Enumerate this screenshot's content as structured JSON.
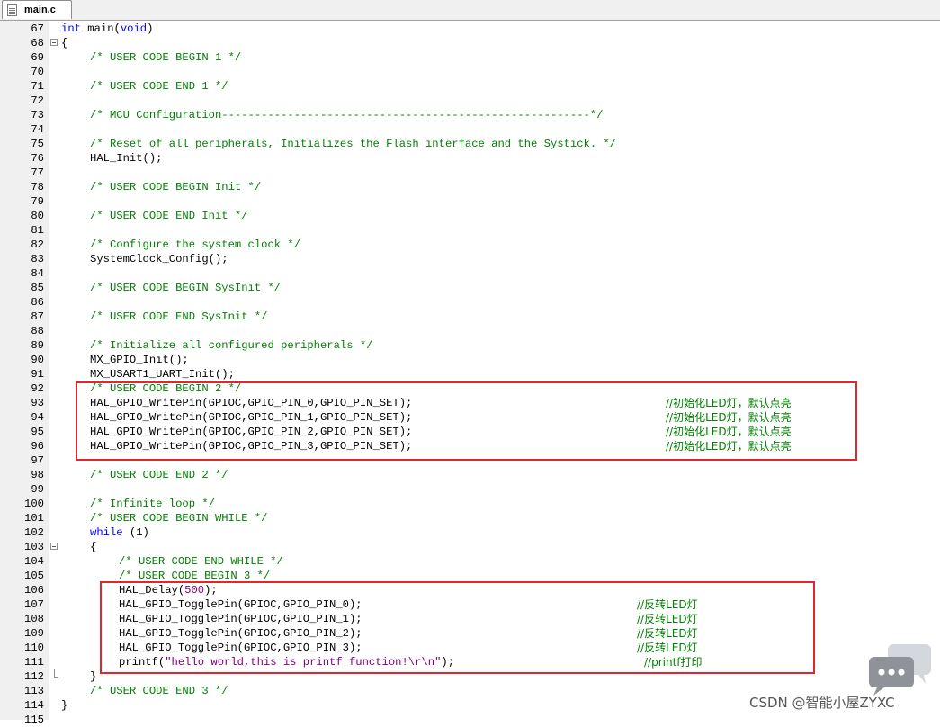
{
  "tab": {
    "filename": "main.c"
  },
  "lines": [
    {
      "n": "67",
      "fold": "",
      "indent": 0,
      "parts": [
        [
          "kw",
          "int"
        ],
        [
          "plain",
          " main("
        ],
        [
          "kw",
          "void"
        ],
        [
          "plain",
          ")"
        ]
      ]
    },
    {
      "n": "68",
      "fold": "open",
      "indent": 0,
      "parts": [
        [
          "plain",
          "{"
        ]
      ]
    },
    {
      "n": "69",
      "fold": "",
      "indent": 4,
      "parts": [
        [
          "cm",
          "/* USER CODE BEGIN 1 */"
        ]
      ]
    },
    {
      "n": "70",
      "fold": "",
      "indent": 0,
      "parts": []
    },
    {
      "n": "71",
      "fold": "",
      "indent": 4,
      "parts": [
        [
          "cm",
          "/* USER CODE END 1 */"
        ]
      ]
    },
    {
      "n": "72",
      "fold": "",
      "indent": 0,
      "parts": []
    },
    {
      "n": "73",
      "fold": "",
      "indent": 4,
      "parts": [
        [
          "cm",
          "/* MCU Configuration--------------------------------------------------------*/"
        ]
      ]
    },
    {
      "n": "74",
      "fold": "",
      "indent": 0,
      "parts": []
    },
    {
      "n": "75",
      "fold": "",
      "indent": 4,
      "parts": [
        [
          "cm",
          "/* Reset of all peripherals, Initializes the Flash interface and the Systick. */"
        ]
      ]
    },
    {
      "n": "76",
      "fold": "",
      "indent": 4,
      "parts": [
        [
          "plain",
          "HAL_Init();"
        ]
      ]
    },
    {
      "n": "77",
      "fold": "",
      "indent": 0,
      "parts": []
    },
    {
      "n": "78",
      "fold": "",
      "indent": 4,
      "parts": [
        [
          "cm",
          "/* USER CODE BEGIN Init */"
        ]
      ]
    },
    {
      "n": "79",
      "fold": "",
      "indent": 0,
      "parts": []
    },
    {
      "n": "80",
      "fold": "",
      "indent": 4,
      "parts": [
        [
          "cm",
          "/* USER CODE END Init */"
        ]
      ]
    },
    {
      "n": "81",
      "fold": "",
      "indent": 0,
      "parts": []
    },
    {
      "n": "82",
      "fold": "",
      "indent": 4,
      "parts": [
        [
          "cm",
          "/* Configure the system clock */"
        ]
      ]
    },
    {
      "n": "83",
      "fold": "",
      "indent": 4,
      "parts": [
        [
          "plain",
          "SystemClock_Config();"
        ]
      ]
    },
    {
      "n": "84",
      "fold": "",
      "indent": 0,
      "parts": []
    },
    {
      "n": "85",
      "fold": "",
      "indent": 4,
      "parts": [
        [
          "cm",
          "/* USER CODE BEGIN SysInit */"
        ]
      ]
    },
    {
      "n": "86",
      "fold": "",
      "indent": 0,
      "parts": []
    },
    {
      "n": "87",
      "fold": "",
      "indent": 4,
      "parts": [
        [
          "cm",
          "/* USER CODE END SysInit */"
        ]
      ]
    },
    {
      "n": "88",
      "fold": "",
      "indent": 0,
      "parts": []
    },
    {
      "n": "89",
      "fold": "",
      "indent": 4,
      "parts": [
        [
          "cm",
          "/* Initialize all configured peripherals */"
        ]
      ]
    },
    {
      "n": "90",
      "fold": "",
      "indent": 4,
      "parts": [
        [
          "plain",
          "MX_GPIO_Init();"
        ]
      ]
    },
    {
      "n": "91",
      "fold": "",
      "indent": 4,
      "parts": [
        [
          "plain",
          "MX_USART1_UART_Init();"
        ]
      ]
    },
    {
      "n": "92",
      "fold": "",
      "indent": 4,
      "parts": [
        [
          "cm",
          "/* USER CODE BEGIN 2 */"
        ]
      ]
    },
    {
      "n": "93",
      "fold": "",
      "indent": 4,
      "parts": [
        [
          "plain",
          "HAL_GPIO_WritePin(GPIOC,GPIO_PIN_0,GPIO_PIN_SET);"
        ]
      ],
      "comment": "//初始化LED灯，默认点亮",
      "ccol": 84
    },
    {
      "n": "94",
      "fold": "",
      "indent": 4,
      "parts": [
        [
          "plain",
          "HAL_GPIO_WritePin(GPIOC,GPIO_PIN_1,GPIO_PIN_SET);"
        ]
      ],
      "comment": "//初始化LED灯，默认点亮",
      "ccol": 84
    },
    {
      "n": "95",
      "fold": "",
      "indent": 4,
      "parts": [
        [
          "plain",
          "HAL_GPIO_WritePin(GPIOC,GPIO_PIN_2,GPIO_PIN_SET);"
        ]
      ],
      "comment": "//初始化LED灯，默认点亮",
      "ccol": 84
    },
    {
      "n": "96",
      "fold": "",
      "indent": 4,
      "parts": [
        [
          "plain",
          "HAL_GPIO_WritePin(GPIOC,GPIO_PIN_3,GPIO_PIN_SET);"
        ]
      ],
      "comment": "//初始化LED灯，默认点亮",
      "ccol": 84
    },
    {
      "n": "97",
      "fold": "",
      "indent": 0,
      "parts": []
    },
    {
      "n": "98",
      "fold": "",
      "indent": 4,
      "parts": [
        [
          "cm",
          "/* USER CODE END 2 */"
        ]
      ]
    },
    {
      "n": "99",
      "fold": "",
      "indent": 0,
      "parts": []
    },
    {
      "n": "100",
      "fold": "",
      "indent": 4,
      "parts": [
        [
          "cm",
          "/* Infinite loop */"
        ]
      ]
    },
    {
      "n": "101",
      "fold": "",
      "indent": 4,
      "parts": [
        [
          "cm",
          "/* USER CODE BEGIN WHILE */"
        ]
      ]
    },
    {
      "n": "102",
      "fold": "",
      "indent": 4,
      "parts": [
        [
          "kw",
          "while"
        ],
        [
          "plain",
          " (1)"
        ]
      ]
    },
    {
      "n": "103",
      "fold": "open",
      "indent": 4,
      "parts": [
        [
          "plain",
          "{"
        ]
      ]
    },
    {
      "n": "104",
      "fold": "",
      "indent": 8,
      "parts": [
        [
          "cm",
          "/* USER CODE END WHILE */"
        ]
      ]
    },
    {
      "n": "105",
      "fold": "",
      "indent": 8,
      "parts": [
        [
          "cm",
          "/* USER CODE BEGIN 3 */"
        ]
      ]
    },
    {
      "n": "106",
      "fold": "",
      "indent": 8,
      "parts": [
        [
          "plain",
          "HAL_Delay("
        ],
        [
          "num",
          "500"
        ],
        [
          "plain",
          ");"
        ]
      ]
    },
    {
      "n": "107",
      "fold": "",
      "indent": 8,
      "parts": [
        [
          "plain",
          "HAL_GPIO_TogglePin(GPIOC,GPIO_PIN_0);"
        ]
      ],
      "comment": "//反转LED灯",
      "ccol": 80
    },
    {
      "n": "108",
      "fold": "",
      "indent": 8,
      "parts": [
        [
          "plain",
          "HAL_GPIO_TogglePin(GPIOC,GPIO_PIN_1);"
        ]
      ],
      "comment": "//反转LED灯",
      "ccol": 80
    },
    {
      "n": "109",
      "fold": "",
      "indent": 8,
      "parts": [
        [
          "plain",
          "HAL_GPIO_TogglePin(GPIOC,GPIO_PIN_2);"
        ]
      ],
      "comment": "//反转LED灯",
      "ccol": 80
    },
    {
      "n": "110",
      "fold": "",
      "indent": 8,
      "parts": [
        [
          "plain",
          "HAL_GPIO_TogglePin(GPIOC,GPIO_PIN_3);"
        ]
      ],
      "comment": "//反转LED灯",
      "ccol": 80
    },
    {
      "n": "111",
      "fold": "",
      "indent": 8,
      "parts": [
        [
          "plain",
          "printf("
        ],
        [
          "str",
          "\"hello world,this is printf function!\\r\\n\""
        ],
        [
          "plain",
          ");"
        ]
      ],
      "comment": "//printf打印",
      "ccol": 81
    },
    {
      "n": "112",
      "fold": "end",
      "indent": 4,
      "parts": [
        [
          "plain",
          "}"
        ]
      ]
    },
    {
      "n": "113",
      "fold": "",
      "indent": 4,
      "parts": [
        [
          "cm",
          "/* USER CODE END 3 */"
        ]
      ]
    },
    {
      "n": "114",
      "fold": "",
      "indent": 0,
      "parts": [
        [
          "plain",
          "}"
        ]
      ]
    },
    {
      "n": "115",
      "fold": "",
      "indent": 0,
      "parts": []
    }
  ],
  "watermark": "CSDN @智能小屋ZYXC",
  "colors": {
    "keyword": "#0000ff",
    "comment": "#008000",
    "string": "#800080",
    "highlight_box": "#e0272f"
  }
}
